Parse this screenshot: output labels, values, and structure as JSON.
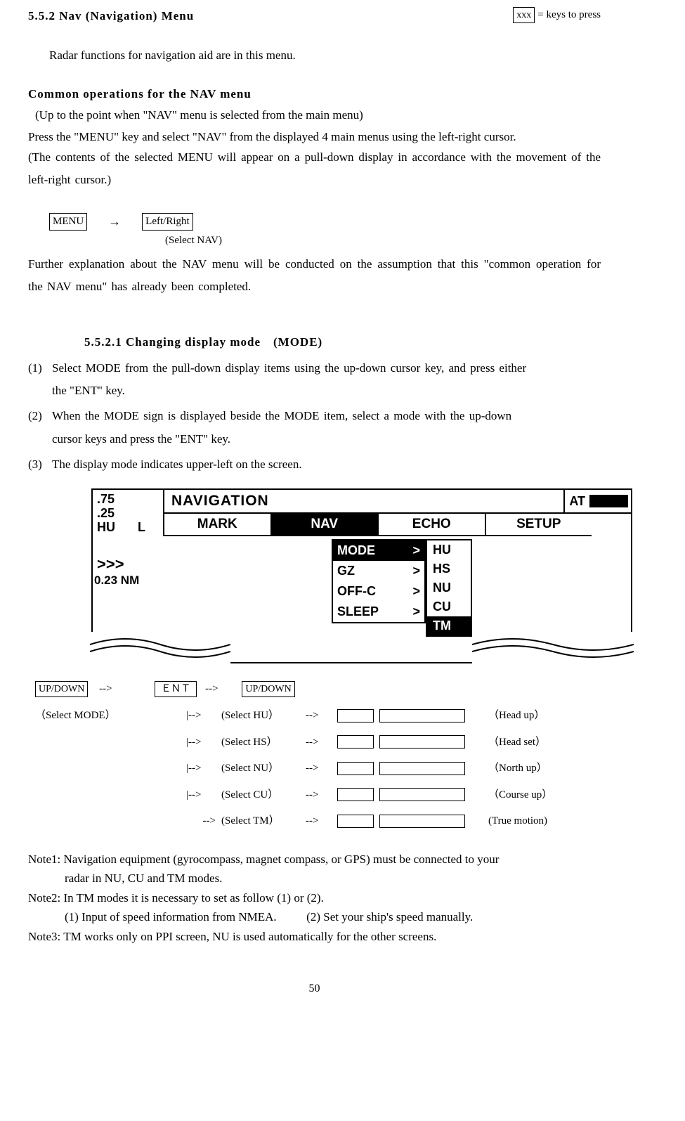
{
  "header": {
    "section_num": "5.5.2 Nav (Navigation) Menu",
    "legend_box": "xxx",
    "legend_text": "= keys to press"
  },
  "intro_para": "Radar functions for navigation aid are in this menu.",
  "common_head": "Common operations for the NAV menu",
  "common_sub": "(Up to the point when \"NAV\" menu is selected from the main menu)",
  "common_p1": "Press the \"MENU\" key and select \"NAV\" from the displayed 4 main menus using the left-right cursor.",
  "common_p2": "(The contents of the selected MENU will appear on a pull-down display in accordance with the movement of the left-right cursor.)",
  "keyseq": {
    "menu": "MENU",
    "arrow": "→",
    "lr": "Left/Right",
    "sel": "(Select NAV)"
  },
  "common_p3": "Further explanation about the NAV menu will be conducted on the assumption that this \"common operation for the NAV menu\" has already been completed.",
  "sub552_1": "5.5.2.1 Changing display mode　(MODE)",
  "steps": {
    "n1": "(1)",
    "s1a": "Select MODE from the pull-down display items using the up-down cursor key, and press either",
    "s1b": "the \"ENT\" key.",
    "n2": "(2)",
    "s2a": "When the MODE sign is displayed beside the MODE item, select a mode with the up-down",
    "s2b": "cursor keys and press the \"ENT\" key.",
    "n3": "(3)",
    "s3": "The display mode indicates upper-left on the screen."
  },
  "diagram": {
    "left": {
      "v1": ".75",
      "v2": ".25",
      "hu": "HU",
      "l": "L",
      "chev": ">>>",
      "nm": "0.23 NM"
    },
    "title": "NAVIGATION",
    "at": "AT",
    "tabs": [
      "MARK",
      "NAV",
      "ECHO",
      "SETUP"
    ],
    "active_tab": 1,
    "dropdown": [
      {
        "label": "MODE",
        "gt": ">",
        "active": true
      },
      {
        "label": "GZ",
        "gt": ">",
        "active": false
      },
      {
        "label": "OFF-C",
        "gt": ">",
        "active": false
      },
      {
        "label": "SLEEP",
        "gt": ">",
        "active": false
      }
    ],
    "submenu": [
      {
        "label": "HU",
        "active": false
      },
      {
        "label": "HS",
        "active": false
      },
      {
        "label": "NU",
        "active": false
      },
      {
        "label": "CU",
        "active": false
      },
      {
        "label": "TM",
        "active": true
      }
    ]
  },
  "flow": {
    "updown": "UP/DOWN",
    "arrow": "-->",
    "ent": "ＥＮＴ",
    "select_mode": "（Select MODE）",
    "branch": "|-->",
    "last_branch": "-->",
    "rows": [
      {
        "pick": "(Select HU）",
        "note": "（Head up）"
      },
      {
        "pick": "(Select HS）",
        "note": "（Head set）"
      },
      {
        "pick": "(Select NU）",
        "note": "（North up）"
      },
      {
        "pick": "(Select CU）",
        "note": "（Course up）"
      },
      {
        "pick": "(Select TM）",
        "note": "(True motion)"
      }
    ]
  },
  "notes": {
    "n1a": "Note1: Navigation equipment (gyrocompass, magnet compass, or GPS) must be connected to your",
    "n1b": "radar in NU, CU and TM modes.",
    "n2": "Note2: In TM modes it is necessary to set as follow (1) or (2).",
    "n2sub": "(1) Input of speed information from NMEA.          (2) Set your ship's speed manually.",
    "n3": "Note3: TM works only on PPI screen, NU is used automatically for the other screens."
  },
  "page": "50"
}
